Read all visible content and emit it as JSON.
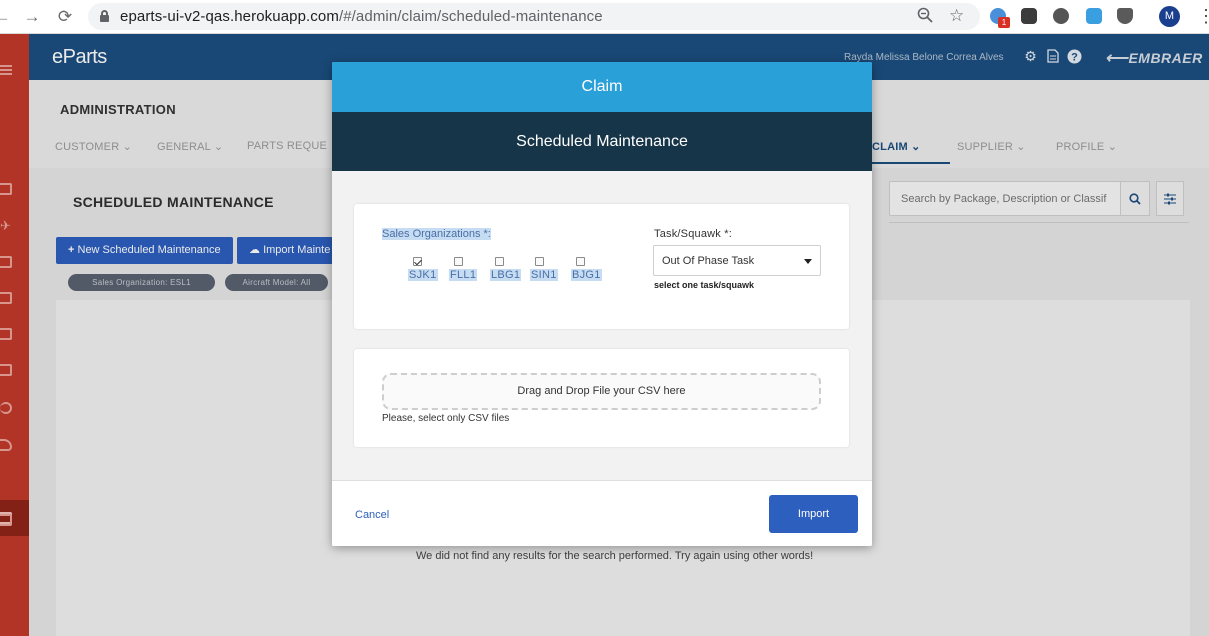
{
  "browser": {
    "url_host": "eparts-ui-v2-qas.herokuapp.com",
    "url_path": "/#/admin/claim/scheduled-maintenance",
    "back_glyph": "←",
    "forward_glyph": "→",
    "reload_glyph": "⟳",
    "extension_badge": "1",
    "profile_initial": "M"
  },
  "app": {
    "logo": "eParts",
    "user_name": "Rayda Melissa Belone Correa Alves",
    "brand": "EMBRAER"
  },
  "admin": {
    "title": "ADMINISTRATION",
    "tabs": [
      {
        "label": "CUSTOMER ⌄"
      },
      {
        "label": "GENERAL ⌄"
      },
      {
        "label": "PARTS REQUE"
      },
      {
        "label": "CLAIM ⌄"
      },
      {
        "label": "SUPPLIER ⌄"
      },
      {
        "label": "PROFILE ⌄"
      }
    ]
  },
  "page": {
    "title": "SCHEDULED MAINTENANCE",
    "search_placeholder": "Search by Package, Description or Classif",
    "new_button": "New Scheduled Maintenance",
    "import_button": "Import Mainte",
    "chips": [
      "Sales Organization: ESL1",
      "Aircraft Model: All"
    ],
    "no_results": "We did not find any results for the search performed. Try again using other words!"
  },
  "modal": {
    "header": "Claim",
    "subheader": "Scheduled Maintenance",
    "sales_org_label": "Sales Organizations *:",
    "sales_orgs": [
      {
        "code": "SJK1",
        "checked": true
      },
      {
        "code": "FLL1",
        "checked": false
      },
      {
        "code": "LBG1",
        "checked": false
      },
      {
        "code": "SIN1",
        "checked": false
      },
      {
        "code": "BJG1",
        "checked": false
      }
    ],
    "task_label": "Task/Squawk *:",
    "task_value": "Out Of Phase Task",
    "task_hint": "select one task/squawk",
    "drop_text": "Drag and Drop File your CSV here",
    "drop_hint": "Please, select only CSV files",
    "cancel": "Cancel",
    "import": "Import"
  },
  "colors": {
    "header_blue": "#1c4f80",
    "modal_header": "#2aa0d9",
    "modal_subheader": "#163548",
    "primary_button": "#2d5fbf",
    "sidebar_red": "#c0392b"
  }
}
